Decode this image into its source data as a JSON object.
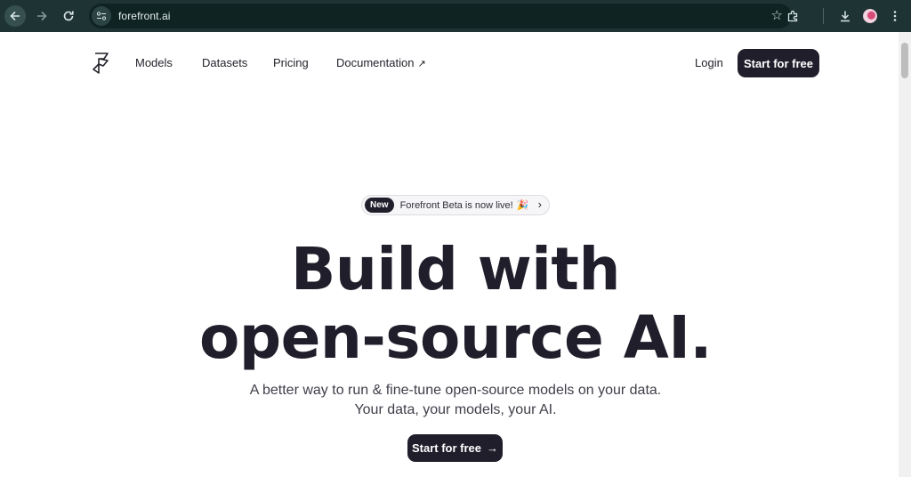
{
  "browser": {
    "url": "forefront.ai"
  },
  "nav": {
    "links": [
      "Models",
      "Datasets",
      "Pricing",
      "Documentation"
    ],
    "external_arrow": "↗",
    "login": "Login",
    "cta": "Start for free"
  },
  "announcement": {
    "badge": "New",
    "text": "Forefront Beta is now live!",
    "emoji": "🎉",
    "chevron": "›"
  },
  "hero": {
    "title_line1": "Build with",
    "title_line2": "open-source AI.",
    "subtitle_line1": "A better way to run & fine-tune open-source models on your data.",
    "subtitle_line2": "Your data, your models, your AI.",
    "cta": "Start for free",
    "cta_arrow": "→"
  },
  "colors": {
    "chrome_bg": "#1e3434",
    "brand_dark": "#201e2b",
    "page_bg": "#ffffff"
  },
  "icons": [
    "back-icon",
    "forward-icon",
    "reload-icon",
    "site-info-icon",
    "star-icon",
    "extensions-icon",
    "download-icon",
    "profile-avatar",
    "kebab-menu-icon",
    "forefront-logo",
    "external-link-icon",
    "chevron-right-icon",
    "arrow-right-icon"
  ]
}
